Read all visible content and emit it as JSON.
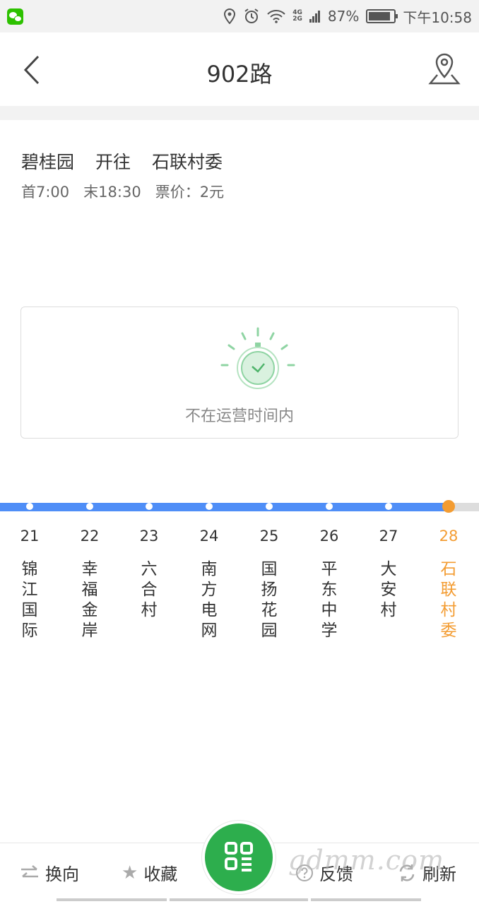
{
  "status_bar": {
    "battery": "87%",
    "time": "下午10:58",
    "network": [
      "4G",
      "2G"
    ],
    "icons": [
      "wechat-icon",
      "location-icon",
      "alarm-icon",
      "wifi-icon",
      "signal-icon",
      "battery-icon"
    ]
  },
  "header": {
    "title": "902路",
    "back_icon": "chevron-left-icon",
    "map_icon": "map-pin-icon"
  },
  "route": {
    "from": "碧桂园",
    "direction": "开往",
    "to": "石联村委",
    "first_bus": "首7:00",
    "last_bus": "末18:30",
    "fare": "票价：2元"
  },
  "status_card": {
    "icon": "stopwatch-icon",
    "message": "不在运营时间内",
    "accent": "#2dae4d"
  },
  "stops": [
    {
      "number": "21",
      "name": "锦江国际"
    },
    {
      "number": "22",
      "name": "幸福金岸"
    },
    {
      "number": "23",
      "name": "六合村"
    },
    {
      "number": "24",
      "name": "南方电网"
    },
    {
      "number": "25",
      "name": "国扬花园"
    },
    {
      "number": "26",
      "name": "平东中学"
    },
    {
      "number": "27",
      "name": "大安村"
    },
    {
      "number": "28",
      "name": "石联村委",
      "current": true
    }
  ],
  "colors": {
    "line_active": "#4f8ef7",
    "current_stop": "#f39c32",
    "brand_green": "#2dae4d"
  },
  "bottom_bar": {
    "reverse": "换向",
    "favorite": "收藏",
    "feedback": "反馈",
    "refresh": "刷新",
    "qr_icon": "qr-scan-icon"
  },
  "watermark": "gdmm.com"
}
